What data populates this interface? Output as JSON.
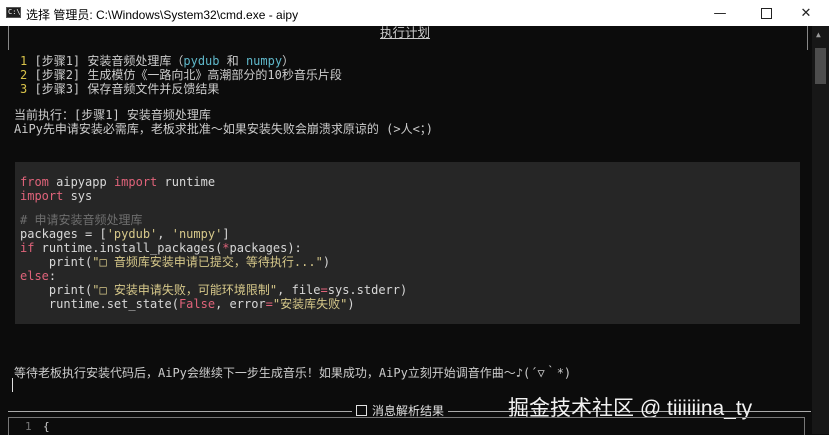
{
  "window": {
    "title": "选择 管理员: C:\\Windows\\System32\\cmd.exe - aipy",
    "app_icon_text": "C:\\"
  },
  "plan": {
    "title": "执行计划",
    "steps": [
      {
        "num": "1",
        "prefix": "[步骤1] 安装音频处理库（",
        "kw1": "pydub",
        "mid": " 和 ",
        "kw2": "numpy",
        "suffix": "）"
      },
      {
        "num": "2",
        "text": "[步骤2] 生成模仿《一路向北》高潮部分的10秒音乐片段"
      },
      {
        "num": "3",
        "text": "[步骤3] 保存音频文件并反馈结果"
      }
    ]
  },
  "current": {
    "line1": "当前执行：[步骤1] 安装音频处理库",
    "line2": "AiPy先申请安装必需库，老板求批准～如果安装失败会崩溃求原谅的 (>人<；)"
  },
  "code": {
    "l1_kw1": "from",
    "l1_mid": " aipyapp ",
    "l1_kw2": "import",
    "l1_end": " runtime",
    "l2_kw": "import",
    "l2_end": " sys",
    "l3_comment": "# 申请安装音频处理库",
    "l4_start": "packages = [",
    "l4_s1": "'pydub'",
    "l4_mid": ", ",
    "l4_s2": "'numpy'",
    "l4_end": "]",
    "l5_kw": "if",
    "l5_mid": " runtime.install_packages(",
    "l5_star": "*",
    "l5_end": "packages):",
    "l6_start": "    print(",
    "l6_str": "\"□ 音频库安装申请已提交，等待执行...\"",
    "l6_end": ")",
    "l7_kw": "else",
    "l7_end": ":",
    "l8_start": "    print(",
    "l8_str": "\"□ 安装申请失败，可能环境限制\"",
    "l8_mid": ", file",
    "l8_eq": "=",
    "l8_end": "sys.stderr)",
    "l9_start": "    runtime.set_state(",
    "l9_kw": "False",
    "l9_mid": ", error",
    "l9_eq": "=",
    "l9_str": "\"安装库失败\"",
    "l9_end": ")"
  },
  "status_line": "等待老板执行安装代码后，AiPy会继续下一步生成音乐！如果成功，AiPy立刻开始调音作曲～♪(´▽｀*)",
  "separator": {
    "label": "消息解析结果"
  },
  "watermark": "掘金技术社区 @ tiiiiiina_ty",
  "bottom": {
    "line_no": "1",
    "text": "{"
  },
  "colors": {
    "background": "#0c0c0c",
    "code_bg": "#262626",
    "keyword": "#e0637a",
    "string": "#d6c88a",
    "number": "#d9c34a",
    "cyan": "#5fb7c9"
  }
}
